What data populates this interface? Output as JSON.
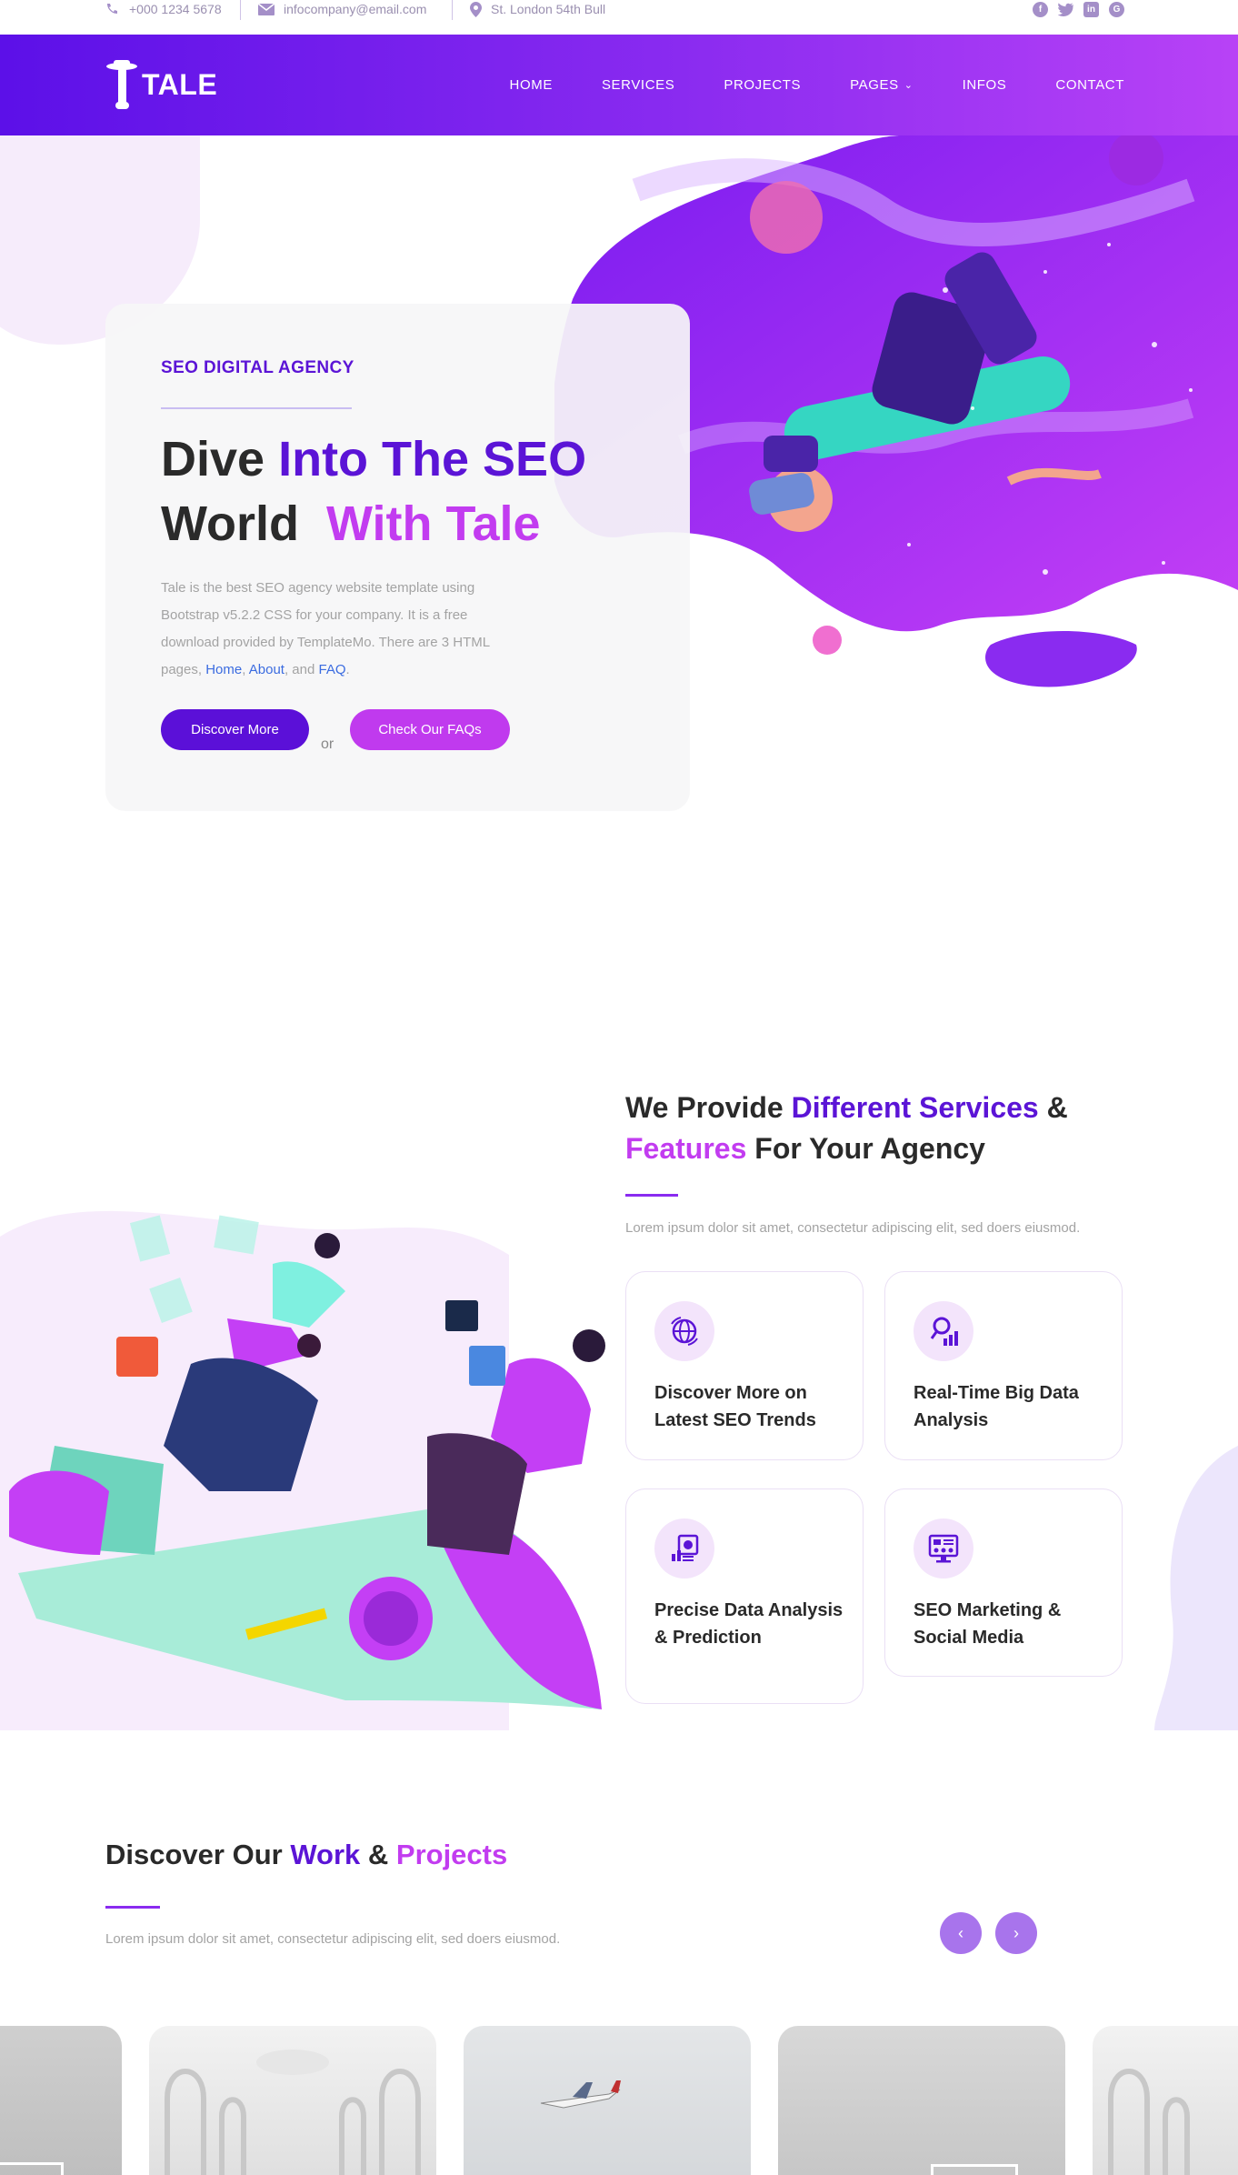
{
  "topbar": {
    "phone": "+000 1234 5678",
    "email": "infocompany@email.com",
    "address": "St. London 54th Bull",
    "social": [
      "facebook-icon",
      "twitter-icon",
      "linkedin-icon",
      "google-plus-icon"
    ]
  },
  "header": {
    "logo_text": "TALE",
    "nav": [
      {
        "label": "HOME"
      },
      {
        "label": "SERVICES"
      },
      {
        "label": "PROJECTS"
      },
      {
        "label": "PAGES",
        "caret": "⌄"
      },
      {
        "label": "INFOS"
      },
      {
        "label": "CONTACT"
      }
    ]
  },
  "hero": {
    "eyebrow": "SEO DIGITAL AGENCY",
    "title_a": "Dive ",
    "title_b": "Into The SEO",
    "title_c": "World  ",
    "title_d": "With Tale",
    "desc_pre": "Tale is the best SEO agency website template using Bootstrap v5.2.2 CSS for your company. It is a free download provided by TemplateMo. There are 3 HTML pages, ",
    "link_home": "Home",
    "link_about": "About",
    "desc_and": ", and ",
    "link_faq": "FAQ",
    "desc_end": ".",
    "btn_discover": "Discover More",
    "or": "or",
    "btn_faq": "Check Our FAQs"
  },
  "services": {
    "title_a": "We Provide ",
    "title_b": "Different Services",
    "title_c": " &",
    "title_d": "Features",
    "title_e": " For Your Agency",
    "subtitle": "Lorem ipsum dolor sit amet, consectetur adipiscing elit, sed doers eiusmod.",
    "cards": [
      {
        "label": "Discover More on Latest SEO Trends",
        "icon": "globe-analytics-icon"
      },
      {
        "label": "Real-Time Big Data Analysis",
        "icon": "search-chart-icon"
      },
      {
        "label": "Precise Data Analysis & Prediction",
        "icon": "report-chart-icon"
      },
      {
        "label": "SEO Marketing & Social Media",
        "icon": "monitor-dashboard-icon"
      }
    ]
  },
  "projects": {
    "title_a": "Discover Our ",
    "title_b": "Work",
    "title_c": " & ",
    "title_d": "Projects",
    "subtitle": "Lorem ipsum dolor sit amet, consectetur adipiscing elit, sed doers eiusmod.",
    "prev": "‹",
    "next": "›"
  }
}
